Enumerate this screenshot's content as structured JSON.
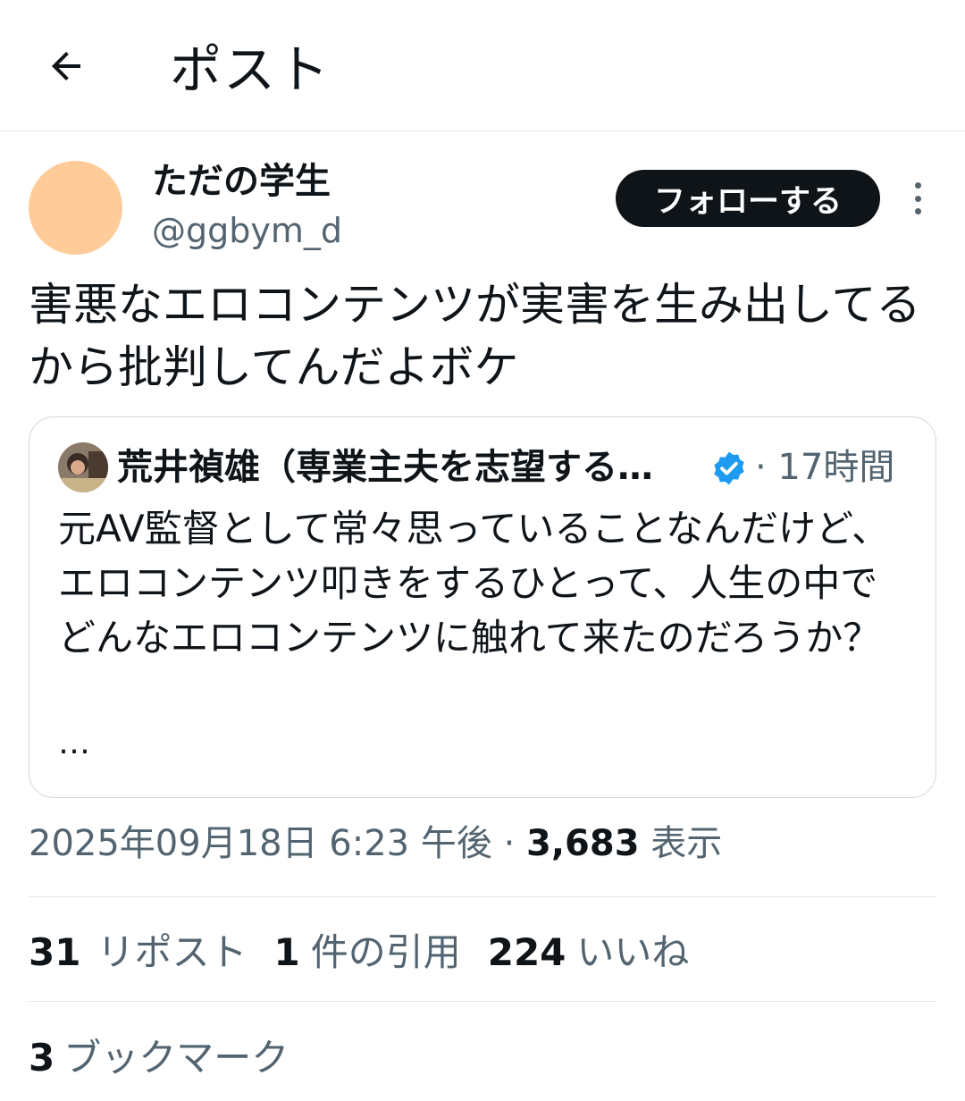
{
  "header": {
    "back_icon": "arrow-left-icon",
    "title": "ポスト"
  },
  "tweet": {
    "author": {
      "name": "ただの学生",
      "handle": "@ggbym_d",
      "avatar_color": "#ffcc99"
    },
    "follow_label": "フォローする",
    "more_icon": "more-vertical-icon",
    "text": "害悪なエロコンテンツが実害を生み出してるから批判してんだよボケ",
    "quote": {
      "author_name": "荒井禎雄（専業主夫を志望する…",
      "verified_icon": "verified-badge-icon",
      "verified_color": "#1d9bf0",
      "time": "· 17時間",
      "text": "元AV監督として常々思っていることなんだけど、エロコンテンツ叩きをするひとって、人生の中でどんなエロコンテンツに触れて来たのだろうか？",
      "ellipsis": "…"
    },
    "timestamp": "2025年09月18日 6:23 午後",
    "separator": " · ",
    "views_count": "3,683",
    "views_label": "表示",
    "stats": {
      "reposts": {
        "count": "31",
        "label": "リポスト"
      },
      "quotes": {
        "count": "1",
        "label": "件の引用"
      },
      "likes": {
        "count": "224",
        "label": "いいね"
      }
    },
    "bookmarks": {
      "count": "3",
      "label": "ブックマーク"
    }
  }
}
